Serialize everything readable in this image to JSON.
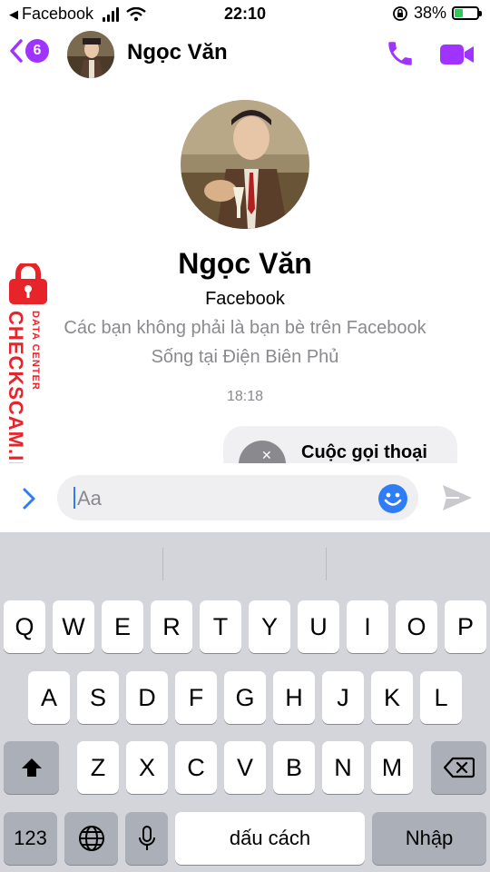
{
  "status_bar": {
    "back_app": "Facebook",
    "time": "22:10",
    "battery_percent": "38%",
    "battery_level": 0.38
  },
  "header": {
    "unread_count": "6",
    "contact_name": "Ngọc Văn"
  },
  "profile": {
    "name": "Ngọc Văn",
    "subtitle": "Facebook",
    "friend_note": "Các bạn không phải là bạn bè trên Facebook",
    "location_note": "Sống tại Điện Biên Phủ"
  },
  "thread": {
    "timestamp": "18:18",
    "call_bubble_text": "Cuộc gọi thoại"
  },
  "watermark": {
    "brand": "CHECKSCAM.INFO",
    "tagline": "DATA CENTER"
  },
  "composer": {
    "placeholder": "Aa"
  },
  "keyboard": {
    "row1": [
      "Q",
      "W",
      "E",
      "R",
      "T",
      "Y",
      "U",
      "I",
      "O",
      "P"
    ],
    "row2": [
      "A",
      "S",
      "D",
      "F",
      "G",
      "H",
      "J",
      "K",
      "L"
    ],
    "row3": [
      "Z",
      "X",
      "C",
      "V",
      "B",
      "N",
      "M"
    ],
    "numbers_key": "123",
    "space_key": "dấu cách",
    "return_key": "Nhập"
  },
  "colors": {
    "accent_purple": "#a033ff",
    "link_blue": "#2e7cf6",
    "watermark_red": "#e8242b"
  }
}
